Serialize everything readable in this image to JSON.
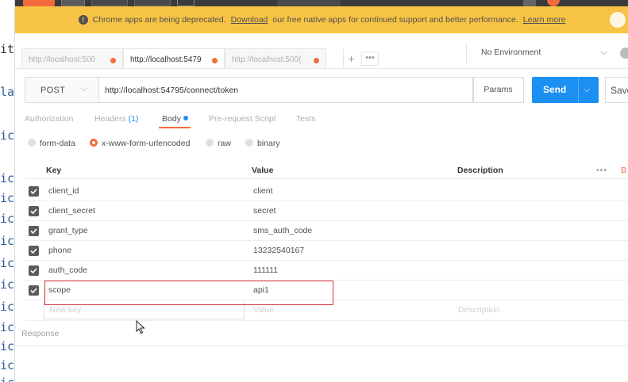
{
  "editor_strip": {
    "lines": [
      "it",
      "la",
      "ic",
      "ic",
      "ic",
      "ic",
      "ic",
      "ic",
      "ic",
      "ic",
      "ic",
      "ic",
      "ic",
      "ic"
    ]
  },
  "banner": {
    "text_before": "Chrome apps are being deprecated.",
    "download_link": "Download",
    "text_after": "our free native apps for continued support and better performance.",
    "learn_more": "Learn more"
  },
  "request_tabs": [
    {
      "label": "http://localhost:500",
      "active": false
    },
    {
      "label": "http://localhost:5479",
      "active": true
    },
    {
      "label": "http://localhost:500(",
      "active": false
    }
  ],
  "environment": {
    "selected": "No Environment"
  },
  "request": {
    "method": "POST",
    "url": "http://localhost:54795/connect/token",
    "params_label": "Params",
    "send_label": "Send",
    "save_label": "Save"
  },
  "sub_tabs": {
    "authorization": "Authorization",
    "headers": "Headers",
    "headers_count": "(1)",
    "body": "Body",
    "pre_request": "Pre-request Script",
    "tests": "Tests",
    "active": "Body"
  },
  "body_types": {
    "form_data": "form-data",
    "urlencoded": "x-www-form-urlencoded",
    "raw": "raw",
    "binary": "binary",
    "selected": "x-www-form-urlencoded"
  },
  "table": {
    "columns": {
      "key": "Key",
      "value": "Value",
      "description": "Description",
      "more": "•••",
      "bulk": "B"
    },
    "rows": [
      {
        "key": "client_id",
        "value": "client",
        "checked": true
      },
      {
        "key": "client_secret",
        "value": "secret",
        "checked": true
      },
      {
        "key": "grant_type",
        "value": "sms_auth_code",
        "checked": true
      },
      {
        "key": "phone",
        "value": "13232540167",
        "checked": true
      },
      {
        "key": "auth_code",
        "value": "111111",
        "checked": true
      },
      {
        "key": "scope",
        "value": "api1",
        "checked": true
      }
    ],
    "new_row": {
      "key_placeholder": "New key",
      "value_placeholder": "Value",
      "description_placeholder": "Description"
    }
  },
  "response": {
    "label": "Response"
  },
  "colors": {
    "accent": "#f26b3a",
    "send": "#1b8ff2",
    "banner": "#f7c344",
    "highlight": "#d6343a"
  }
}
